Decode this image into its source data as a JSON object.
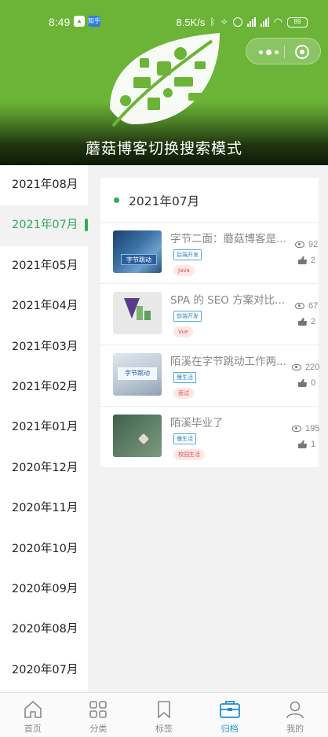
{
  "status_bar": {
    "time": "8:49",
    "app_badge": "知乎",
    "net_speed": "8.5K/s",
    "battery": "89"
  },
  "header": {
    "title": "蘑菇博客切换搜索模式",
    "brand_color": "#6bb437"
  },
  "sidebar": {
    "items": [
      {
        "label": "2021年08月",
        "active": false
      },
      {
        "label": "2021年07月",
        "active": true
      },
      {
        "label": "2021年05月",
        "active": false
      },
      {
        "label": "2021年04月",
        "active": false
      },
      {
        "label": "2021年03月",
        "active": false
      },
      {
        "label": "2021年02月",
        "active": false
      },
      {
        "label": "2021年01月",
        "active": false
      },
      {
        "label": "2020年12月",
        "active": false
      },
      {
        "label": "2020年11月",
        "active": false
      },
      {
        "label": "2020年10月",
        "active": false
      },
      {
        "label": "2020年09月",
        "active": false
      },
      {
        "label": "2020年08月",
        "active": false
      },
      {
        "label": "2020年07月",
        "active": false
      }
    ],
    "active_color": "#33aa55"
  },
  "archive": {
    "month_title": "2021年07月",
    "posts": [
      {
        "title": "字节二面：蘑菇博客是...",
        "category": "后端开发",
        "tag": "Java",
        "views": "92",
        "likes": "2"
      },
      {
        "title": "SPA 的 SEO 方案对比...",
        "category": "前端开发",
        "tag": "Vue",
        "views": "67",
        "likes": "2"
      },
      {
        "title": "陌溪在字节跳动工作两...",
        "category": "慢生活",
        "tag": "面试",
        "views": "220",
        "likes": "0"
      },
      {
        "title": "陌溪毕业了",
        "category": "慢生活",
        "tag": "校园生活",
        "views": "195",
        "likes": "1"
      }
    ]
  },
  "tabbar": {
    "tabs": [
      {
        "label": "首页",
        "icon": "home-icon",
        "active": false
      },
      {
        "label": "分类",
        "icon": "grid-icon",
        "active": false
      },
      {
        "label": "标签",
        "icon": "bookmark-icon",
        "active": false
      },
      {
        "label": "归档",
        "icon": "archive-box-icon",
        "active": true
      },
      {
        "label": "我的",
        "icon": "user-icon",
        "active": false
      }
    ],
    "active_color": "#1e8fd6"
  }
}
